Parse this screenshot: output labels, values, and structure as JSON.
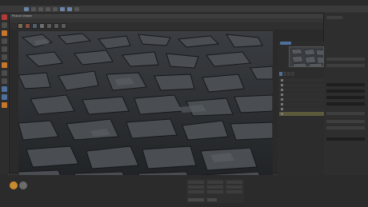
{
  "viewer": {
    "title": "Picture Viewer"
  }
}
